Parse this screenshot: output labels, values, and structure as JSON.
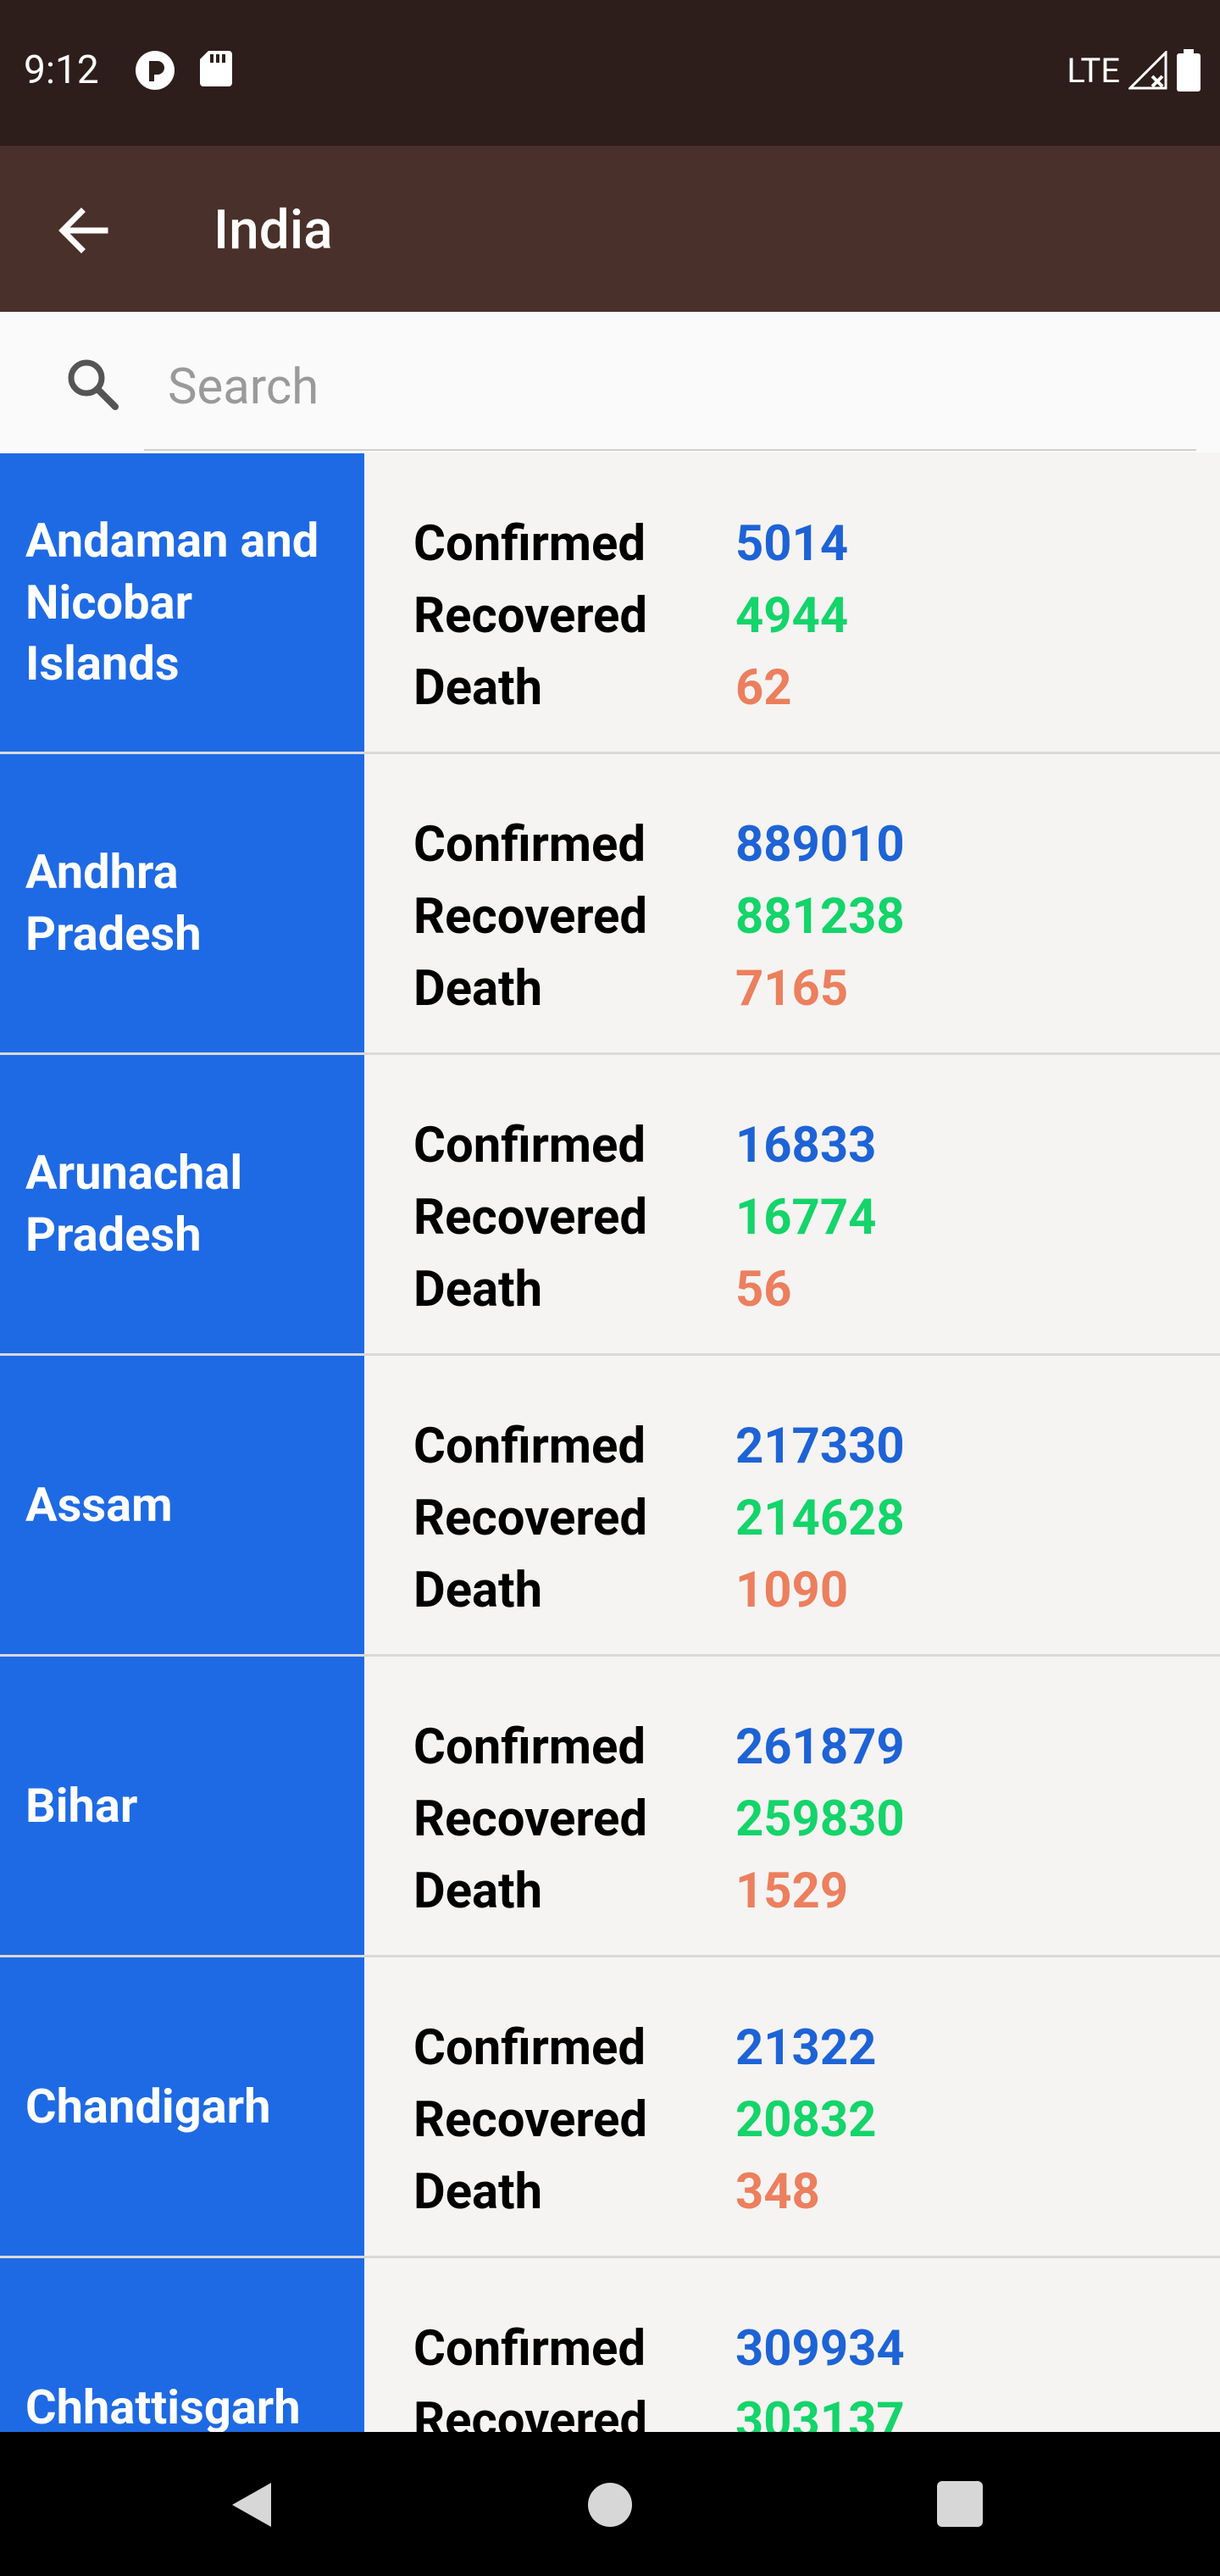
{
  "status_bar": {
    "time": "9:12",
    "network": "LTE"
  },
  "app_bar": {
    "title": "India"
  },
  "search": {
    "placeholder": "Search",
    "value": ""
  },
  "labels": {
    "confirmed": "Confirmed",
    "recovered": "Recovered",
    "death": "Death"
  },
  "colors": {
    "status_bar": "#2E1E1B",
    "app_bar": "#4A302A",
    "state_cell": "#1E6AE5",
    "confirmed": "#1E63D6",
    "recovered": "#14D46A",
    "death": "#EC7F5E"
  },
  "states": [
    {
      "name": "Andaman and Nicobar Islands",
      "confirmed": "5014",
      "recovered": "4944",
      "death": "62"
    },
    {
      "name": "Andhra Pradesh",
      "confirmed": "889010",
      "recovered": "881238",
      "death": "7165"
    },
    {
      "name": "Arunachal Pradesh",
      "confirmed": "16833",
      "recovered": "16774",
      "death": "56"
    },
    {
      "name": "Assam",
      "confirmed": "217330",
      "recovered": "214628",
      "death": "1090"
    },
    {
      "name": "Bihar",
      "confirmed": "261879",
      "recovered": "259830",
      "death": "1529"
    },
    {
      "name": "Chandigarh",
      "confirmed": "21322",
      "recovered": "20832",
      "death": "348"
    },
    {
      "name": "Chhattisgarh",
      "confirmed": "309934",
      "recovered": "303137",
      "death": ""
    }
  ]
}
